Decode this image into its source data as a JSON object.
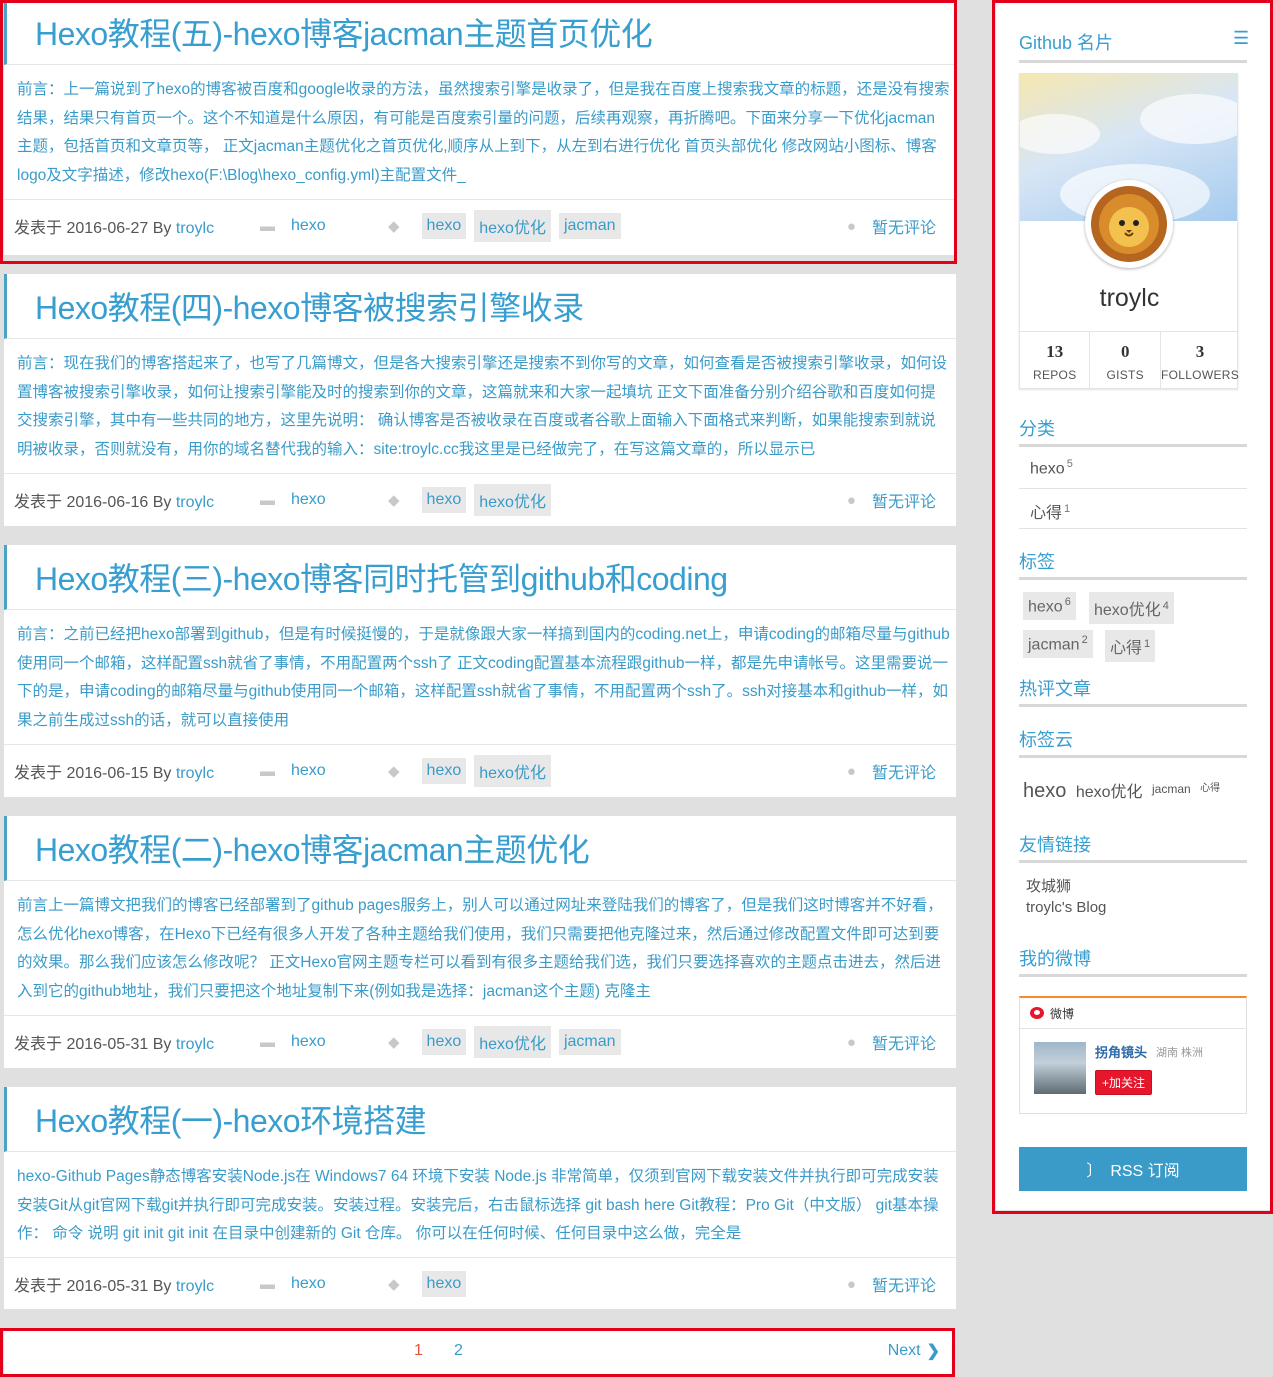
{
  "posts": [
    {
      "title": "Hexo教程(五)-hexo博客jacman主题首页优化",
      "excerpt": "前言：上一篇说到了hexo的博客被百度和google收录的方法，虽然搜索引擎是收录了，但是我在百度上搜索我文章的标题，还是没有搜索结果，结果只有首页一个。这个不知道是什么原因，有可能是百度索引量的问题，后续再观察，再折腾吧。下面来分享一下优化jacman主题，包括首页和文章页等， 正文jacman主题优化之首页优化,顺序从上到下，从左到右进行优化 首页头部优化 修改网站小图标、博客logo及文字描述，修改hexo(F:\\Blog\\hexo_config.yml)主配置文件_",
      "date_prefix": "发表于 2016-06-27 By ",
      "author": "troylc",
      "category": "hexo",
      "tags": [
        "hexo",
        "hexo优化",
        "jacman"
      ],
      "comments": "暂无评论"
    },
    {
      "title": "Hexo教程(四)-hexo博客被搜索引擎收录",
      "excerpt": "前言：现在我们的博客搭起来了，也写了几篇博文，但是各大搜索引擎还是搜索不到你写的文章，如何查看是否被搜索引擎收录，如何设置博客被搜索引擎收录，如何让搜索引擎能及时的搜索到你的文章，这篇就来和大家一起填坑 正文下面准备分别介绍谷歌和百度如何提交搜索引擎，其中有一些共同的地方，这里先说明： 确认博客是否被收录在百度或者谷歌上面输入下面格式来判断，如果能搜索到就说明被收录，否则就没有，用你的域名替代我的输入：site:troylc.cc我这里是已经做完了，在写这篇文章的，所以显示已",
      "date_prefix": "发表于 2016-06-16 By ",
      "author": "troylc",
      "category": "hexo",
      "tags": [
        "hexo",
        "hexo优化"
      ],
      "comments": "暂无评论"
    },
    {
      "title": "Hexo教程(三)-hexo博客同时托管到github和coding",
      "excerpt": "前言：之前已经把hexo部署到github，但是有时候挺慢的，于是就像跟大家一样搞到国内的coding.net上，申请coding的邮箱尽量与github使用同一个邮箱，这样配置ssh就省了事情，不用配置两个ssh了 正文coding配置基本流程跟github一样，都是先申请帐号。这里需要说一下的是，申请coding的邮箱尽量与github使用同一个邮箱，这样配置ssh就省了事情，不用配置两个ssh了。ssh对接基本和github一样，如果之前生成过ssh的话，就可以直接使用",
      "date_prefix": "发表于 2016-06-15 By ",
      "author": "troylc",
      "category": "hexo",
      "tags": [
        "hexo",
        "hexo优化"
      ],
      "comments": "暂无评论"
    },
    {
      "title": "Hexo教程(二)-hexo博客jacman主题优化",
      "excerpt": "前言上一篇博文把我们的博客已经部署到了github pages服务上，别人可以通过网址来登陆我们的博客了，但是我们这时博客并不好看，怎么优化hexo博客，在Hexo下已经有很多人开发了各种主题给我们使用，我们只需要把他克隆过来，然后通过修改配置文件即可达到要的效果。那么我们应该怎么修改呢？ 正文Hexo官网主题专栏可以看到有很多主题给我们选，我们只要选择喜欢的主题点击进去，然后进入到它的github地址，我们只要把这个地址复制下来(例如我是选择：jacman这个主题) 克隆主",
      "date_prefix": "发表于 2016-05-31 By ",
      "author": "troylc",
      "category": "hexo",
      "tags": [
        "hexo",
        "hexo优化",
        "jacman"
      ],
      "comments": "暂无评论"
    },
    {
      "title": "Hexo教程(一)-hexo环境搭建",
      "excerpt": "hexo-Github Pages静态博客安装Node.js在 Windows7 64 环境下安装 Node.js 非常简单，仅须到官网下载安装文件并执行即可完成安装 安装Git从git官网下载git并执行即可完成安装。安装过程。安装完后，右击鼠标选择 git bash here Git教程：Pro Git（中文版） git基本操作： 命令 说明 git init git init 在目录中创建新的 Git 仓库。 你可以在任何时候、任何目录中这么做，完全是",
      "date_prefix": "发表于 2016-05-31 By ",
      "author": "troylc",
      "category": "hexo",
      "tags": [
        "hexo"
      ],
      "comments": "暂无评论"
    }
  ],
  "pager": {
    "page1": "1",
    "page2": "2",
    "next": "Next"
  },
  "sidebar": {
    "github_title": "Github 名片",
    "github_user": "troylc",
    "stats": [
      {
        "num": "13",
        "label": "REPOS"
      },
      {
        "num": "0",
        "label": "GISTS"
      },
      {
        "num": "3",
        "label": "FOLLOWERS"
      }
    ],
    "category_title": "分类",
    "categories": [
      {
        "name": "hexo",
        "count": "5"
      },
      {
        "name": "心得",
        "count": "1"
      }
    ],
    "tags_title": "标签",
    "tags": [
      {
        "name": "hexo",
        "count": "6"
      },
      {
        "name": "hexo优化",
        "count": "4"
      },
      {
        "name": "jacman",
        "count": "2"
      },
      {
        "name": "心得",
        "count": "1"
      }
    ],
    "hot_title": "热评文章",
    "cloud_title": "标签云",
    "cloud": [
      "hexo",
      "hexo优化",
      "jacman",
      "心得"
    ],
    "links_title": "友情链接",
    "links": [
      "攻城狮",
      "troylc's Blog"
    ],
    "weibo_title": "我的微博",
    "weibo": {
      "brand": "微博",
      "name": "拐角镜头",
      "location": "湖南 株洲",
      "follow": "+加关注"
    },
    "rss": "RSS 订阅"
  }
}
